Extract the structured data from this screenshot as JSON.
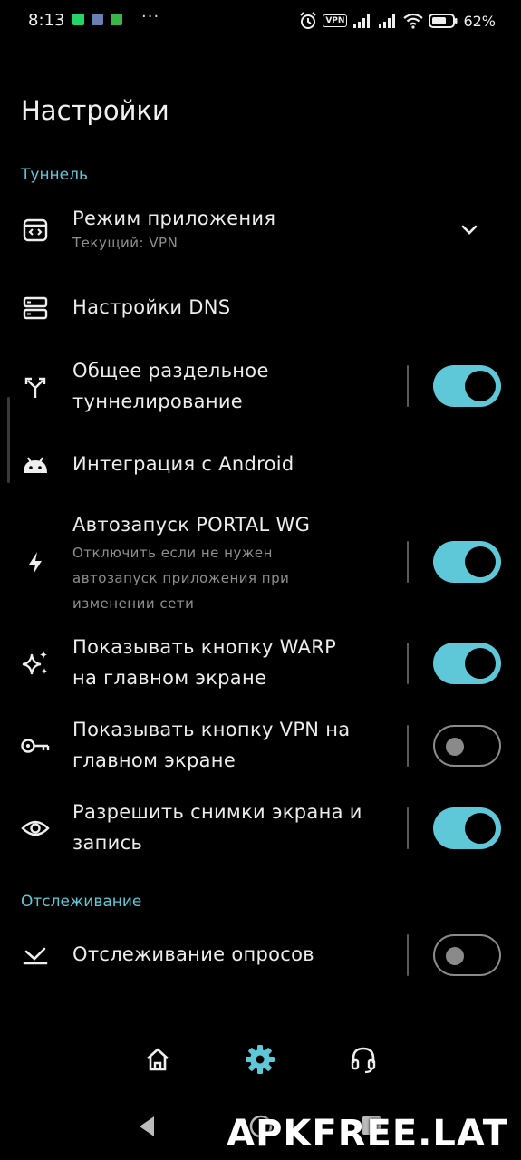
{
  "status_bar": {
    "time": "8:13",
    "vpn_label": "VPN",
    "battery": "62%",
    "dots": "···"
  },
  "title": "Настройки",
  "sections": {
    "tunnel": "Туннель",
    "tracking": "Отслеживание"
  },
  "items": {
    "app_mode": {
      "title": "Режим приложения",
      "subtitle": "Текущий: VPN",
      "icon": "code-window-icon"
    },
    "dns": {
      "title": "Настройки DNS",
      "icon": "dns-server-icon"
    },
    "split_tunnel": {
      "title_line1": "Общее раздельное",
      "title_line2": "туннелирование",
      "icon": "split-arrows-icon",
      "enabled": true
    },
    "android": {
      "title": "Интеграция с Android",
      "icon": "android-icon"
    },
    "autostart": {
      "title": "Автозапуск PORTAL WG",
      "sub_line1": "Отключить если не нужен",
      "sub_line2": "автозапуск приложения при",
      "sub_line3": "изменении сети",
      "icon": "bolt-icon",
      "enabled": true
    },
    "warp_button": {
      "title_line1": "Показывать кнопку WARP",
      "title_line2": "на главном экране",
      "icon": "sparkle-icon",
      "enabled": true
    },
    "vpn_button": {
      "title_line1": "Показывать кнопку VPN на",
      "title_line2": "главном экране",
      "icon": "key-icon",
      "enabled": false
    },
    "screenshots": {
      "title_line1": "Разрешить снимки экрана и",
      "title_line2": "запись",
      "icon": "eye-icon",
      "enabled": true
    },
    "polling": {
      "title": "Отслеживание опросов",
      "icon": "tracking-check-icon",
      "enabled": false
    }
  },
  "bottom_nav": [
    "home-icon",
    "settings-gear-icon",
    "headset-icon"
  ],
  "watermark": "APKFREE.LAT",
  "colors": {
    "accent": "#5ec8d8",
    "background": "#000000",
    "subtext": "#8e8e8e"
  }
}
